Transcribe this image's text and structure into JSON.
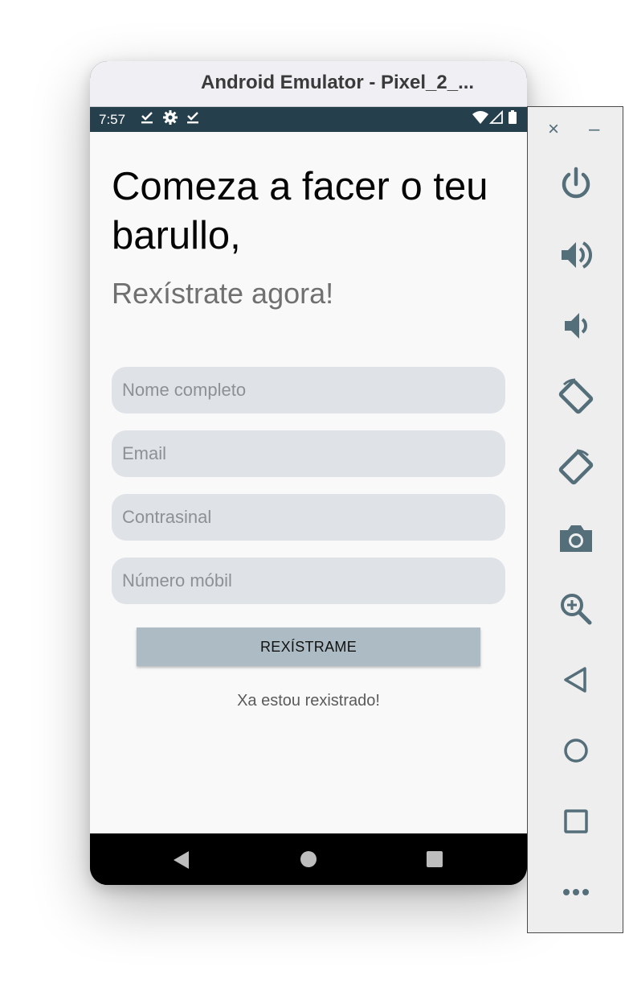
{
  "window": {
    "title": "Android Emulator - Pixel_2_..."
  },
  "status_bar": {
    "time": "7:57",
    "icons": [
      "download-done-icon",
      "settings-icon",
      "download-done-icon",
      "wifi-icon",
      "signal-icon",
      "battery-icon"
    ]
  },
  "app": {
    "headline": "Comeza a facer o teu barullo,",
    "subheadline": "Rexístrate agora!",
    "fields": [
      {
        "placeholder": "Nome completo",
        "value": ""
      },
      {
        "placeholder": "Email",
        "value": ""
      },
      {
        "placeholder": "Contrasinal",
        "value": ""
      },
      {
        "placeholder": "Número móbil",
        "value": ""
      }
    ],
    "register_button": "REXÍSTRAME",
    "login_link": "Xa estou rexistrado!"
  },
  "nav_bar": {
    "buttons": [
      "back",
      "home",
      "recents"
    ]
  },
  "emulator_toolbar": {
    "close_glyph": "×",
    "minimize_glyph": "–",
    "tools": [
      "power",
      "volume-up",
      "volume-down",
      "rotate-left",
      "rotate-right",
      "screenshot",
      "zoom",
      "back",
      "home",
      "overview",
      "more"
    ],
    "icon_color": "#546e7a"
  },
  "colors": {
    "status_bar": "#263f4c",
    "screen_background": "#f9f9f9",
    "field_background": "#dfe2e6",
    "button_background": "#adbcc4"
  }
}
